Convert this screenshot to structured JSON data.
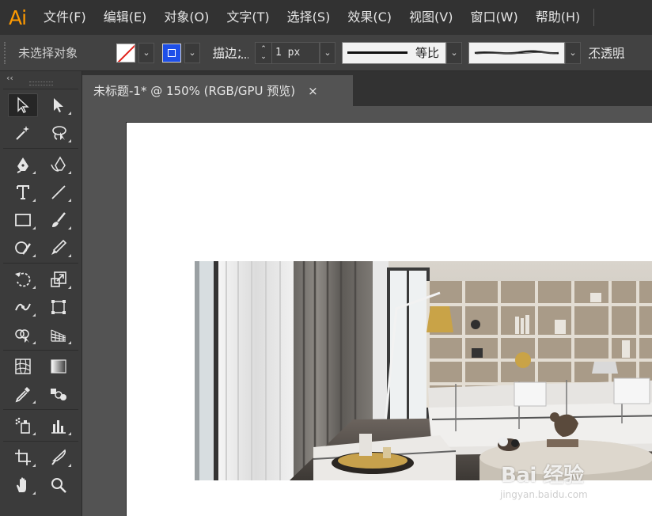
{
  "app": {
    "logo": "Ai"
  },
  "menu": [
    {
      "label": "文件(F)"
    },
    {
      "label": "编辑(E)"
    },
    {
      "label": "对象(O)"
    },
    {
      "label": "文字(T)"
    },
    {
      "label": "选择(S)"
    },
    {
      "label": "效果(C)"
    },
    {
      "label": "视图(V)"
    },
    {
      "label": "窗口(W)"
    },
    {
      "label": "帮助(H)"
    }
  ],
  "control_bar": {
    "selection_status": "未选择对象",
    "stroke_label": "描边：",
    "stroke_weight": "1 px",
    "profile_label": "等比",
    "opacity_label": "不透明",
    "fill_color": "none",
    "stroke_color": "#1e4fe8"
  },
  "document": {
    "tab_title": "未标题-1* @ 150% (RGB/GPU 预览)",
    "close_glyph": "×"
  },
  "toolbar": {
    "collapse_glyph": "‹‹",
    "tools": [
      [
        "selection-tool-icon",
        "direct-selection-tool-icon"
      ],
      [
        "magic-wand-tool-icon",
        "lasso-tool-icon"
      ],
      [
        "pen-tool-icon",
        "curvature-tool-icon"
      ],
      [
        "type-tool-icon",
        "line-segment-tool-icon"
      ],
      [
        "rectangle-tool-icon",
        "paintbrush-tool-icon"
      ],
      [
        "shaper-tool-icon",
        "eraser-tool-icon"
      ],
      [
        "rotate-tool-icon",
        "scale-tool-icon"
      ],
      [
        "width-tool-icon",
        "free-transform-tool-icon"
      ],
      [
        "shape-builder-tool-icon",
        "perspective-grid-tool-icon"
      ],
      [
        "mesh-tool-icon",
        "gradient-tool-icon"
      ],
      [
        "eyedropper-tool-icon",
        "blend-tool-icon"
      ],
      [
        "symbol-sprayer-tool-icon",
        "column-graph-tool-icon"
      ],
      [
        "artboard-tool-icon",
        "slice-tool-icon"
      ],
      [
        "hand-tool-icon",
        "zoom-tool-icon"
      ]
    ]
  },
  "watermark": {
    "logo": "Bai 经验",
    "url": "jingyan.baidu.com"
  }
}
